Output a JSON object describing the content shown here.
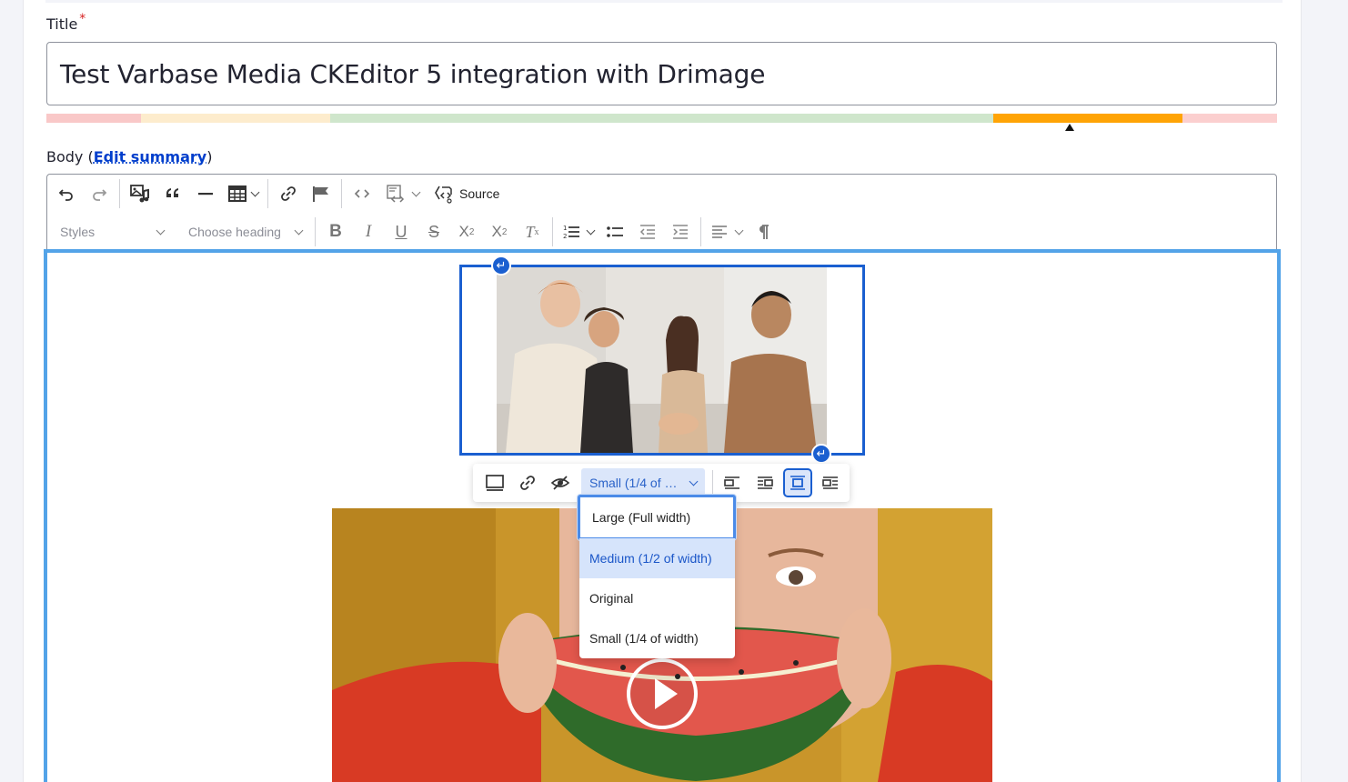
{
  "title_field": {
    "label": "Title",
    "required_mark": "*",
    "value": "Test Varbase Media CKEditor 5 integration with Drimage"
  },
  "readability_bar": {
    "colors": [
      "#f9c8c8",
      "#fdeccd",
      "#cfe6cc",
      "#ffa406",
      "#fbcfcf"
    ]
  },
  "body_field": {
    "label_prefix": "Body (",
    "edit_summary_link": "Edit summary",
    "label_suffix": ")"
  },
  "toolbar": {
    "row1": [
      "undo-icon",
      "redo-icon",
      "insert-media-icon",
      "blockquote-icon",
      "horizontal-line-icon",
      "table-icon",
      "link-icon",
      "anchor-flag-icon",
      "code-icon",
      "code-block-icon"
    ],
    "source_label": "Source",
    "styles_placeholder": "Styles",
    "heading_placeholder": "Choose heading",
    "row2": [
      "bold-icon",
      "italic-icon",
      "underline-icon",
      "strikethrough-icon",
      "subscript-icon",
      "superscript-icon",
      "remove-format-icon",
      "numbered-list-icon",
      "bulleted-list-icon",
      "outdent-icon",
      "indent-icon",
      "align-icon",
      "paragraph-icon"
    ]
  },
  "media_toolbar": {
    "size_selected": "Small (1/4 of …",
    "buttons": [
      "media-display-icon",
      "media-link-icon",
      "hide-caption-icon",
      "align-left-icon",
      "wrap-text-icon",
      "align-center-icon",
      "break-text-icon"
    ]
  },
  "size_menu": {
    "options": [
      "Large (Full width)",
      "Medium (1/2 of width)",
      "Original",
      "Small (1/4 of width)"
    ],
    "focused_index": 0,
    "highlighted_index": 1
  },
  "handles": {
    "symbol": "↵"
  },
  "accent_color": "#1a5fd0"
}
